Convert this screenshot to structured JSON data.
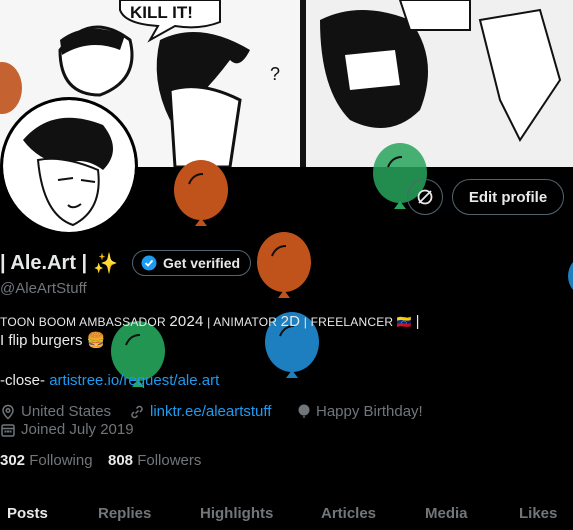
{
  "profile": {
    "display_name": "| Ale.Art |",
    "sparkle_emoji": "✨",
    "get_verified_label": "Get verified",
    "handle": "@AleArtStuff",
    "edit_profile_label": "Edit profile",
    "bio": {
      "line1_part1": "TOON BOOM AMBASSADOR",
      "line1_year": "2024",
      "line1_part2": "| ANIMATOR",
      "line1_2d": "2D",
      "line1_part3": "| FREELANCER",
      "line1_flag": "🇻🇪",
      "line1_end": "|",
      "line2": "I flip burgers 🍔",
      "line3_prefix": "-close-",
      "line3_link": "artistree.io/request/ale.art"
    },
    "location": "United States",
    "website": "linktr.ee/aleartstuff",
    "birthday": "Happy Birthday!",
    "joined": "Joined July 2019",
    "following_count": "302",
    "following_label": "Following",
    "followers_count": "808",
    "followers_label": "Followers",
    "banner_text": "KILL IT!"
  },
  "tabs": [
    "Posts",
    "Replies",
    "Highlights",
    "Articles",
    "Media",
    "Likes"
  ],
  "colors": {
    "accent": "#1d9bf0",
    "balloon_orange": "#c0521c",
    "balloon_green": "#27a55c",
    "balloon_blue": "#1d7fc0"
  },
  "icons": [
    "refresh-circle-icon",
    "verified-badge-icon",
    "location-icon",
    "link-icon",
    "balloon-icon",
    "calendar-icon"
  ]
}
